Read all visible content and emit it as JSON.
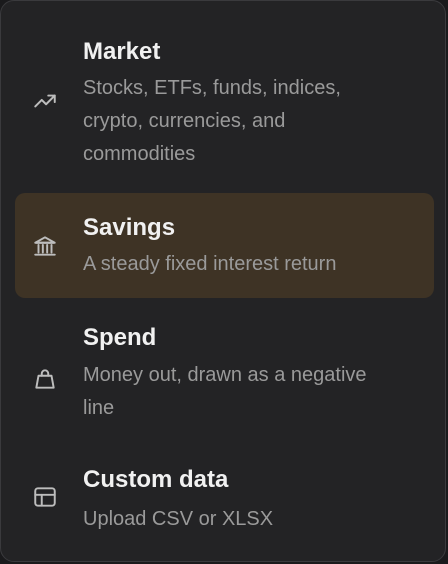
{
  "menu": {
    "items": [
      {
        "title": "Market",
        "description": "Stocks, ETFs, funds, indices, crypto, currencies, and commodities",
        "icon": "trending-up-icon",
        "selected": false
      },
      {
        "title": "Savings",
        "description": "A steady fixed interest return",
        "icon": "bank-icon",
        "selected": true
      },
      {
        "title": "Spend",
        "description": "Money out, drawn as a negative line",
        "icon": "shopping-bag-icon",
        "selected": false
      },
      {
        "title": "Custom data",
        "description": "Upload CSV or XLSX",
        "icon": "layout-table-icon",
        "selected": false
      }
    ]
  },
  "colors": {
    "background": "#232325",
    "selected_background": "#3e3325",
    "title_text": "#f1f1f1",
    "description_text": "#9a9a9a",
    "icon": "#bdbdbd"
  }
}
